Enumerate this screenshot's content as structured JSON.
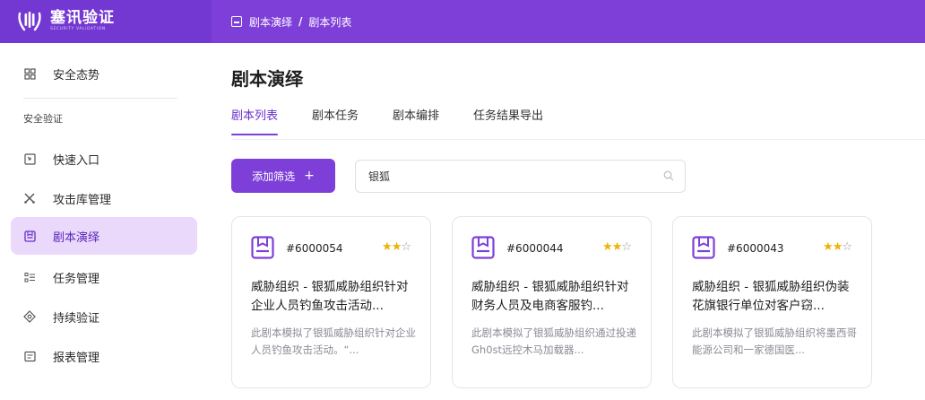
{
  "brand": {
    "name": "塞讯验证",
    "subtitle": "SECURITY VALIDATION"
  },
  "breadcrumb": {
    "parent": "剧本演绎",
    "separator": "/",
    "current": "剧本列表"
  },
  "sidebar": {
    "items": [
      {
        "label": "安全态势",
        "icon": "dashboard-icon"
      },
      {
        "label": "快速入口",
        "icon": "quick-entry-icon"
      },
      {
        "label": "攻击库管理",
        "icon": "attack-library-icon"
      },
      {
        "label": "剧本演绎",
        "icon": "playbook-icon"
      },
      {
        "label": "任务管理",
        "icon": "task-list-icon"
      },
      {
        "label": "持续验证",
        "icon": "continuous-icon"
      },
      {
        "label": "报表管理",
        "icon": "report-icon"
      }
    ],
    "group_label": "安全验证",
    "active": "剧本演绎"
  },
  "main": {
    "title": "剧本演绎",
    "tabs": [
      {
        "label": "剧本列表"
      },
      {
        "label": "剧本任务"
      },
      {
        "label": "剧本编排"
      },
      {
        "label": "任务结果导出"
      }
    ],
    "active_tab": "剧本列表",
    "filter_button": {
      "label": "添加筛选",
      "icon": "+"
    },
    "search": {
      "value": "银狐",
      "placeholder": ""
    }
  },
  "cards": [
    {
      "id": "#6000054",
      "rating": 2,
      "max_rating": 3,
      "title": "威胁组织 - 银狐威胁组织针对企业人员钓鱼攻击活动...",
      "description": "此剧本模拟了银狐威胁组织针对企业人员钓鱼攻击活动。“..."
    },
    {
      "id": "#6000044",
      "rating": 2,
      "max_rating": 3,
      "title": "威胁组织 - 银狐威胁组织针对财务人员及电商客服钓...",
      "description": "此剧本模拟了银狐威胁组织通过投递Gh0st远控木马加载器..."
    },
    {
      "id": "#6000043",
      "rating": 2,
      "max_rating": 3,
      "title": "威胁组织 - 银狐威胁组织伪装花旗银行单位对客户窃...",
      "description": "此剧本模拟了银狐威胁组织将墨西哥能源公司和一家德国医..."
    }
  ],
  "colors": {
    "accent": "#7e3fd9",
    "header": "#7e3fd9",
    "active_bg": "#ead9fb",
    "star": "#eab308"
  }
}
